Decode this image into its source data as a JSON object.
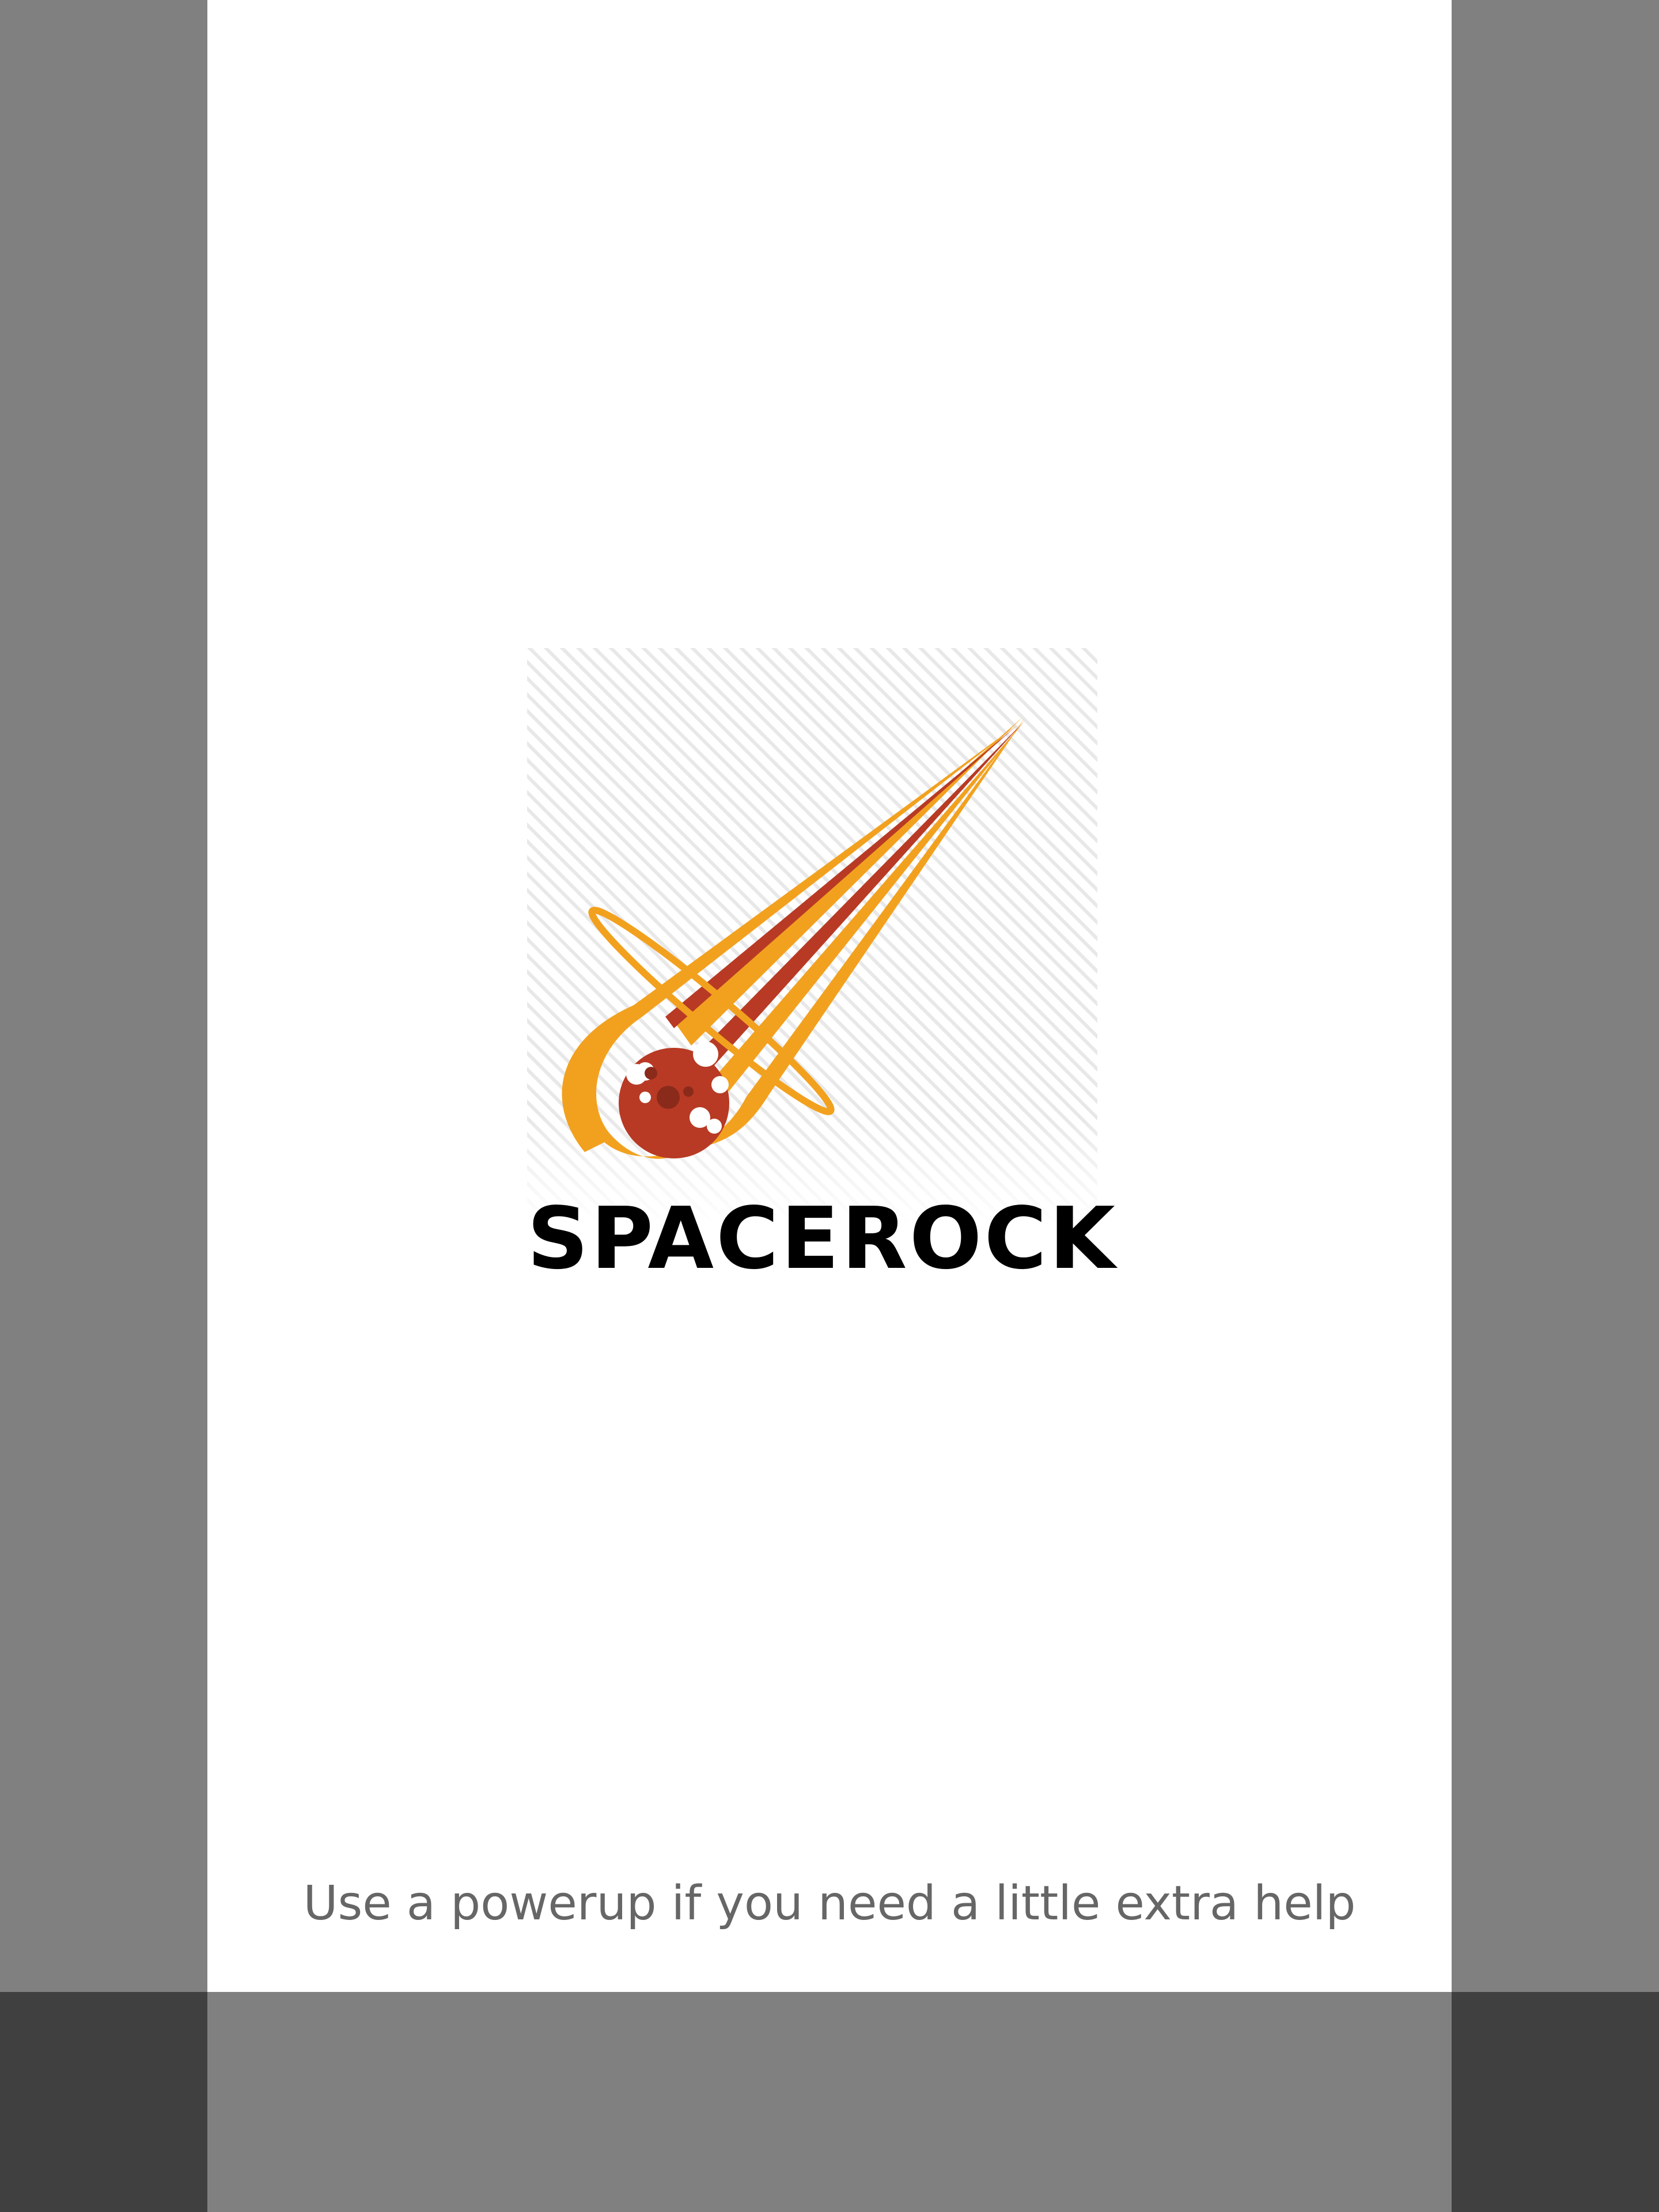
{
  "splash": {
    "logo_text": "SPACEROCK",
    "tip": "Use a powerup if you need a little extra help"
  },
  "icons": {
    "logo": "meteor-logo-icon"
  },
  "colors": {
    "frame_gray": "#808080",
    "corner_dark_gray": "#404040",
    "panel_white": "#ffffff",
    "flame_orange": "#f2a11f",
    "meteor_red": "#b83a24",
    "tip_gray": "#666666",
    "logo_text_black": "#000000"
  }
}
